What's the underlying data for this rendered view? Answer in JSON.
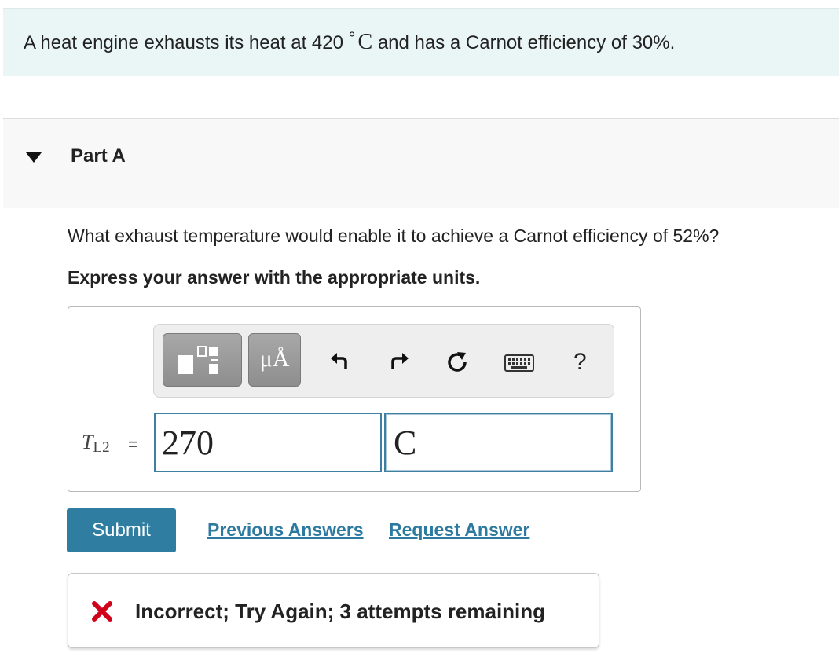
{
  "problem": {
    "text_before": "A heat engine exhausts its heat at 420",
    "degree": "°",
    "unit": "C",
    "text_after": "and has a Carnot efficiency of 30%."
  },
  "part": {
    "title": "Part A",
    "question": "What exhaust temperature would enable it to achieve a Carnot efficiency of 52%?",
    "instructions": "Express your answer with the appropriate units."
  },
  "toolbar": {
    "templates_icon": "templates-icon",
    "units_label": "μÅ",
    "undo_icon": "undo-icon",
    "redo_icon": "redo-icon",
    "reset_icon": "reset-icon",
    "keyboard_icon": "keyboard-icon",
    "help_label": "?"
  },
  "answer": {
    "variable": "T",
    "subscript": "L2",
    "equals": "=",
    "value": "270",
    "unit": "C"
  },
  "actions": {
    "submit_label": "Submit",
    "previous_answers_label": "Previous Answers",
    "request_answer_label": "Request Answer"
  },
  "feedback": {
    "icon": "incorrect-x-icon",
    "text": "Incorrect; Try Again; 3 attempts remaining",
    "icon_color": "#d0021b"
  },
  "colors": {
    "accent": "#2f7ea1",
    "banner_bg": "#eaf6f6",
    "input_border": "#3f7f9f"
  }
}
